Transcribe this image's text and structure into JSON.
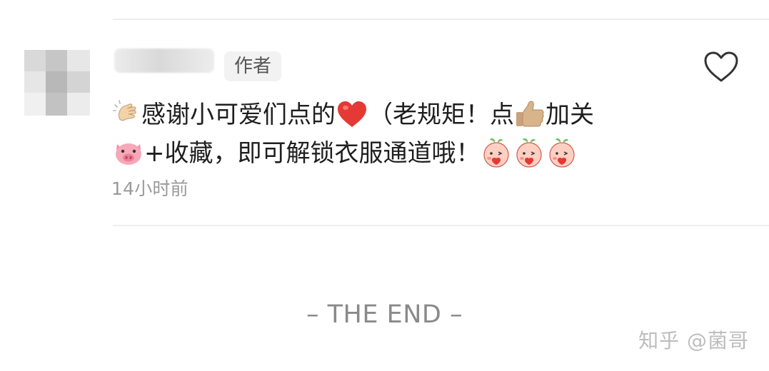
{
  "author_badge": "作者",
  "comment": {
    "part1": "感谢小可爱们点的",
    "part2": "（老规矩！点",
    "part3": "加关",
    "part4": "+收藏，即可解锁衣服通道哦！",
    "emojis": [
      "clap-icon",
      "red-heart-icon",
      "thumbs-up-icon",
      "pig-face-icon",
      "peach-kiss-icon"
    ]
  },
  "timestamp": "14小时前",
  "footer": {
    "end_text": "– THE END –",
    "watermark": "知乎 @菌哥"
  },
  "colors": {
    "text": "#1f1f1f",
    "muted": "#9a9a9a",
    "badge_bg": "#f2f2f2",
    "divider": "#eeeeee",
    "heart_red": "#e53935",
    "pig_pink": "#f7a8b8"
  }
}
